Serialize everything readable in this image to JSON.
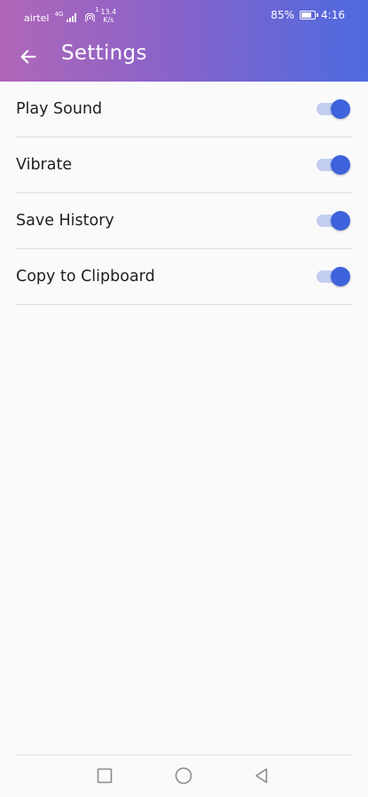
{
  "status_bar": {
    "carrier": "airtel",
    "network_type": "4G",
    "speed_superscript": "1",
    "speed_value": "13.4",
    "speed_unit": "K/s",
    "battery_percent": "85%",
    "battery_level": 0.85,
    "time": "4:16"
  },
  "header": {
    "title": "Settings",
    "back_icon": "arrow-left-icon"
  },
  "settings": [
    {
      "label": "Play Sound",
      "enabled": true
    },
    {
      "label": "Vibrate",
      "enabled": true
    },
    {
      "label": "Save History",
      "enabled": true
    },
    {
      "label": "Copy to Clipboard",
      "enabled": true
    }
  ],
  "nav_bar": {
    "icons": [
      "recent-apps-square-icon",
      "home-circle-icon",
      "back-triangle-icon"
    ]
  },
  "colors": {
    "header_gradient_start": "#b066b8",
    "header_gradient_end": "#4d6ae0",
    "switch_thumb": "#3e63dc",
    "switch_track": "#c2cdf2",
    "background": "#fafafa"
  }
}
